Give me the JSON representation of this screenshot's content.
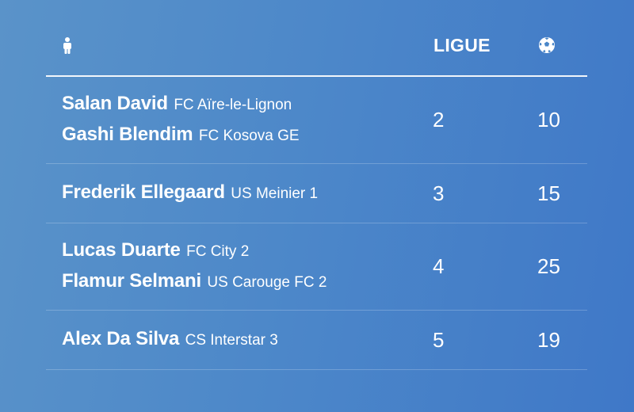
{
  "header": {
    "player_icon": "person-icon",
    "league_label": "LIGUE",
    "goals_icon": "soccer-ball-icon"
  },
  "rows": [
    {
      "players": [
        {
          "name": "Salan David",
          "club": "FC Aïre-le-Lignon"
        },
        {
          "name": "Gashi Blendim",
          "club": "FC Kosova GE"
        }
      ],
      "league": "2",
      "goals": "10"
    },
    {
      "players": [
        {
          "name": "Frederik Ellegaard",
          "club": "US Meinier 1"
        }
      ],
      "league": "3",
      "goals": "15"
    },
    {
      "players": [
        {
          "name": "Lucas Duarte",
          "club": "FC City 2"
        },
        {
          "name": "Flamur Selmani",
          "club": "US Carouge FC 2"
        }
      ],
      "league": "4",
      "goals": "25"
    },
    {
      "players": [
        {
          "name": "Alex Da Silva",
          "club": "CS Interstar 3"
        }
      ],
      "league": "5",
      "goals": "19"
    }
  ]
}
